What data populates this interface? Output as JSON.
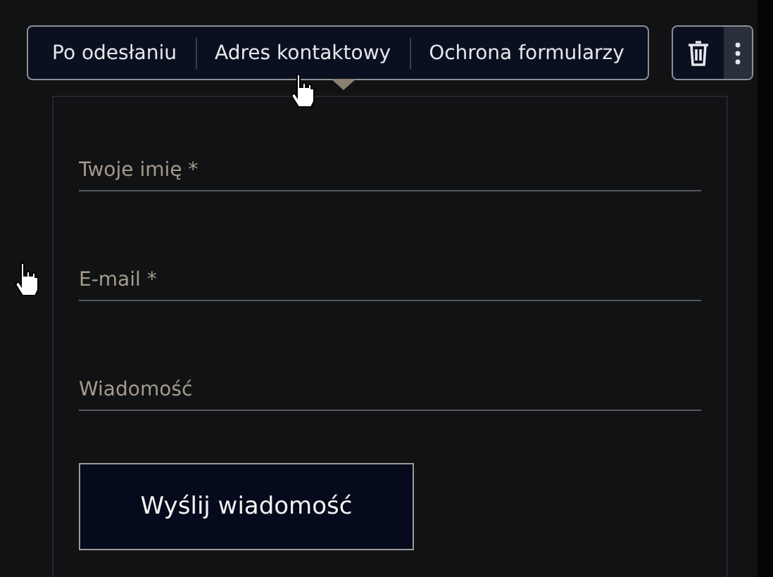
{
  "toolbar": {
    "items": [
      {
        "label": "Po odesłaniu"
      },
      {
        "label": "Adres kontaktowy"
      },
      {
        "label": "Ochrona formularzy"
      }
    ]
  },
  "form": {
    "fields": [
      {
        "placeholder": "Twoje imię *"
      },
      {
        "placeholder": "E-mail *"
      },
      {
        "placeholder": "Wiadomość"
      }
    ],
    "submit": "Wyślij wiadomość"
  }
}
